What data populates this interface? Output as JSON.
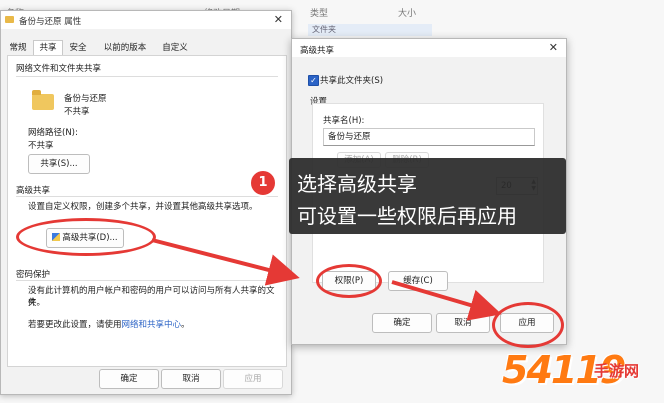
{
  "background": {
    "col_name": "名称",
    "col_modified": "修改日期",
    "col_type": "类型",
    "col_size": "大小",
    "folder_row": "文件夹"
  },
  "properties_window": {
    "title": "备份与还原 属性",
    "tabs": [
      "常规",
      "共享",
      "安全",
      "以前的版本",
      "自定义"
    ],
    "active_tab": "共享",
    "network_section_title": "网络文件和文件夹共享",
    "folder_name": "备份与还原",
    "share_status": "不共享",
    "network_path_label": "网络路径(N):",
    "network_path_value": "不共享",
    "share_button": "共享(S)...",
    "advanced_section_title": "高级共享",
    "advanced_description": "设置自定义权限，创建多个共享，并设置其他高级共享选项。",
    "advanced_button": "高级共享(D)...",
    "password_section_title": "密码保护",
    "password_description_line1": "没有此计算机的用户帐户和密码的用户可以访问与所有人共享的文件",
    "password_description_line2": "夹。",
    "password_change_prefix": "若要更改此设置，请使用",
    "password_change_link": "网络和共享中心",
    "password_change_suffix": "。",
    "ok_button": "确定",
    "cancel_button": "取消",
    "apply_button": "应用"
  },
  "advanced_dialog": {
    "title": "高级共享",
    "share_checkbox_label": "共享此文件夹(S)",
    "share_checkbox_checked": true,
    "settings_label": "设置",
    "share_name_label": "共享名(H):",
    "share_name_value": "备份与还原",
    "add_button": "添加(A)",
    "remove_button": "删除(R)",
    "limit_value": "20",
    "permissions_button": "权限(P)",
    "caching_button": "缓存(C)",
    "ok_button": "确定",
    "cancel_button": "取消",
    "apply_button": "应用"
  },
  "annotation": {
    "step_number": "1",
    "line1": "选择高级共享",
    "line2": "可设置一些权限后再应用",
    "color": "#e53935"
  },
  "watermark": {
    "number": "54119",
    "text": "手游网"
  }
}
